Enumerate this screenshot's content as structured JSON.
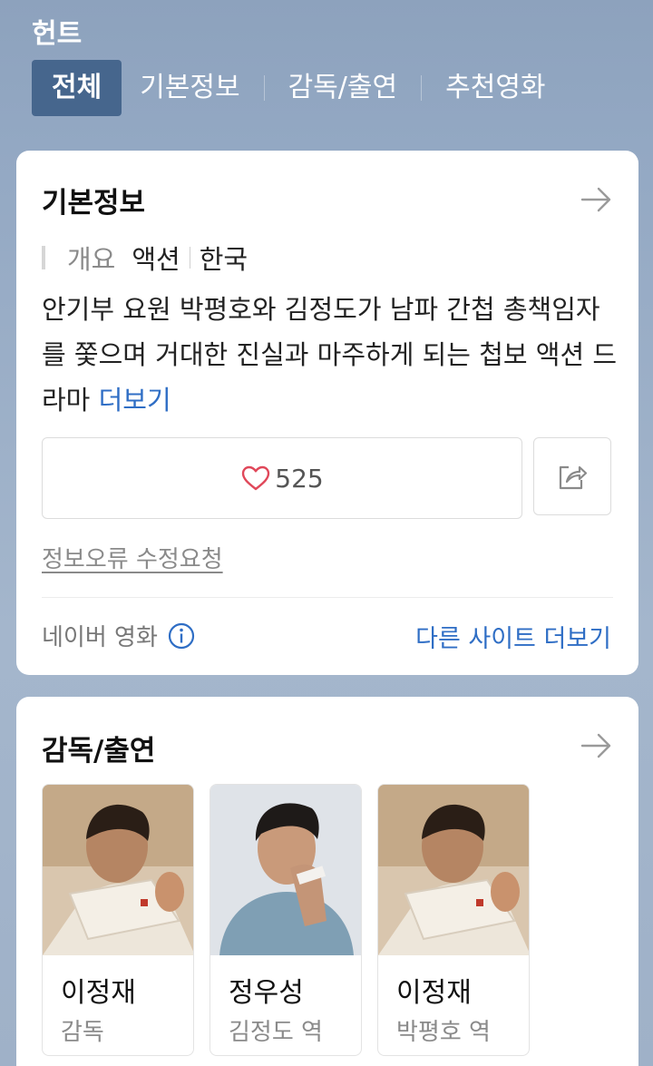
{
  "movie": {
    "title": "헌트"
  },
  "tabs": [
    {
      "label": "전체"
    },
    {
      "label": "기본정보"
    },
    {
      "label": "감독/출연"
    },
    {
      "label": "추천영화"
    }
  ],
  "info_card": {
    "title": "기본정보",
    "meta_label": "개요",
    "genre": "액션",
    "country": "한국",
    "synopsis": "안기부 요원 박평호와 김정도가 남파 간첩 총책임자를 쫓으며 거대한 진실과 마주하게 되는 첩보 액션 드라마",
    "more_label": "더보기",
    "likes": "525",
    "report_label": "정보오류 수정요청",
    "source_label": "네이버 영화",
    "other_sites_label": "다른 사이트 더보기"
  },
  "cast_card": {
    "title": "감독/출연",
    "people": [
      {
        "name": "이정재",
        "role": "감독"
      },
      {
        "name": "정우성",
        "role": "김정도 역"
      },
      {
        "name": "이정재",
        "role": "박평호 역"
      }
    ]
  },
  "colors": {
    "header_bg": "#8da2bd",
    "active_tab": "#46668d",
    "link_blue": "#2f6ec5",
    "heart_red": "#e0485a"
  }
}
